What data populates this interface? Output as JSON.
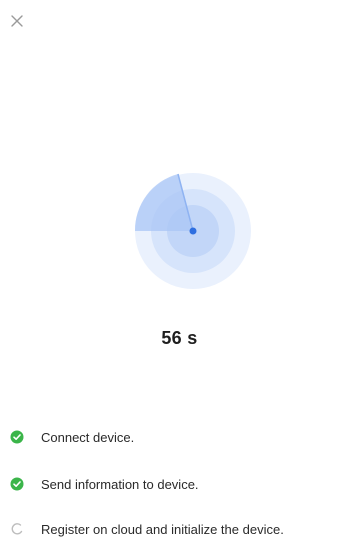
{
  "header": {
    "close_icon": "close-icon"
  },
  "progress": {
    "timer_text": "56 s",
    "radar_colors": {
      "outer": "#eaf1fd",
      "middle": "#d6e4fb",
      "inner": "#c2d6f8",
      "sweep": "#a9c6f6",
      "dot": "#2f6fe0"
    }
  },
  "steps": [
    {
      "label": "Connect device.",
      "status": "done",
      "icon": "check-circle-icon"
    },
    {
      "label": "Send information to device.",
      "status": "done",
      "icon": "check-circle-icon"
    },
    {
      "label": "Register on cloud and initialize the device.",
      "status": "in-progress",
      "icon": "spinner-icon"
    }
  ],
  "colors": {
    "success": "#3bb54a",
    "pending": "#bdbdbd"
  }
}
